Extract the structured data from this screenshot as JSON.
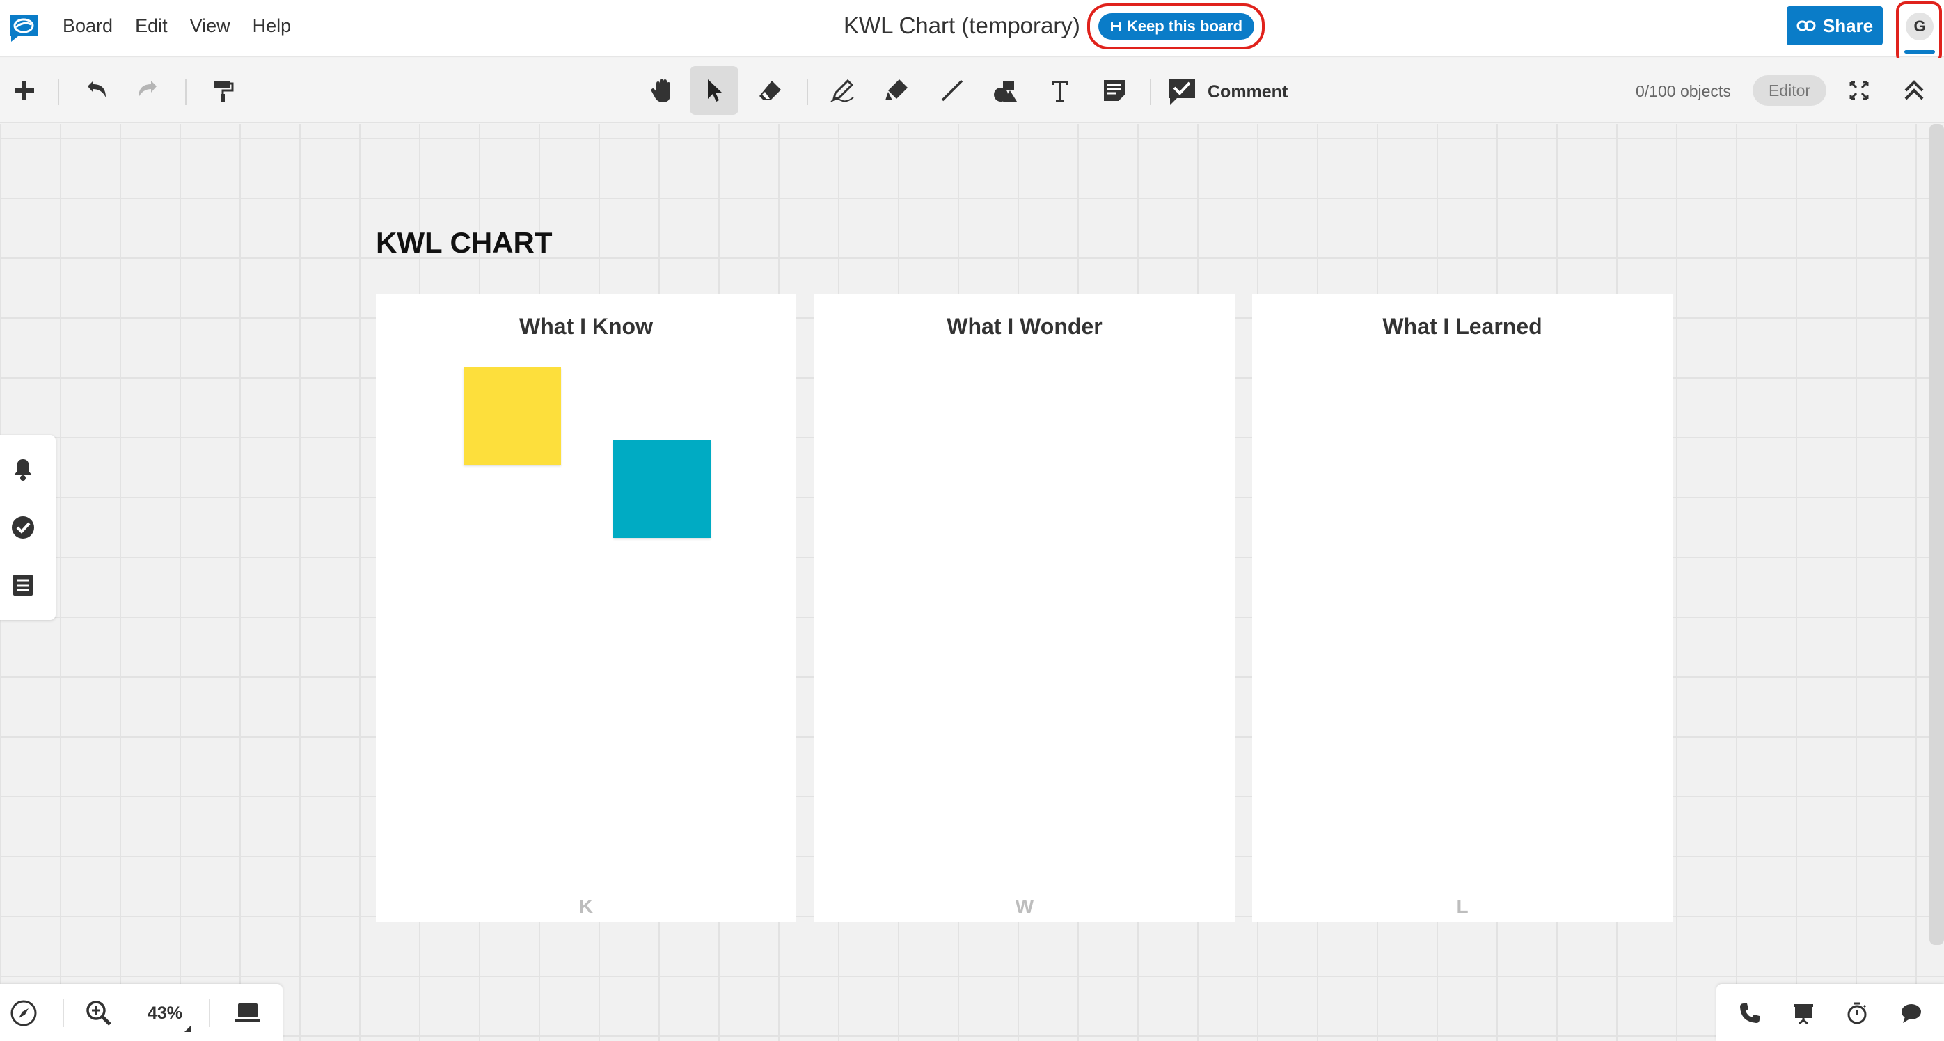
{
  "menu": {
    "items": [
      "Board",
      "Edit",
      "View",
      "Help"
    ]
  },
  "header": {
    "board_title": "KWL Chart (temporary)",
    "keep_board_label": "Keep this board",
    "share_label": "Share",
    "avatar_initial": "G"
  },
  "toolbar": {
    "comment_label": "Comment",
    "object_count": "0/100 objects",
    "role_label": "Editor",
    "icons": [
      "plus-icon",
      "undo-icon",
      "redo-icon",
      "format-painter-icon",
      "hand-icon",
      "select-arrow-icon",
      "eraser-icon",
      "pen-icon",
      "highlighter-icon",
      "line-icon",
      "shapes-icon",
      "text-icon",
      "sticky-note-icon",
      "comment-icon",
      "fullscreen-icon",
      "collapse-icon"
    ]
  },
  "board": {
    "title": "KWL CHART",
    "columns": [
      {
        "heading": "What I Know",
        "letter": "K"
      },
      {
        "heading": "What I Wonder",
        "letter": "W"
      },
      {
        "heading": "What I Learned",
        "letter": "L"
      }
    ],
    "sticky_notes": [
      {
        "color": "#fddf3c"
      },
      {
        "color": "#00abc3"
      }
    ]
  },
  "side_panel": {
    "icons": [
      "bell-icon",
      "check-circle-icon",
      "list-icon"
    ]
  },
  "bottom_left": {
    "zoom_level": "43%",
    "icons": [
      "compass-icon",
      "zoom-in-icon",
      "screen-icon"
    ]
  },
  "bottom_right": {
    "icons": [
      "phone-icon",
      "presentation-icon",
      "timer-icon",
      "chat-icon"
    ]
  },
  "colors": {
    "accent": "#0a7cc8",
    "highlight_outline": "#e0221c"
  }
}
